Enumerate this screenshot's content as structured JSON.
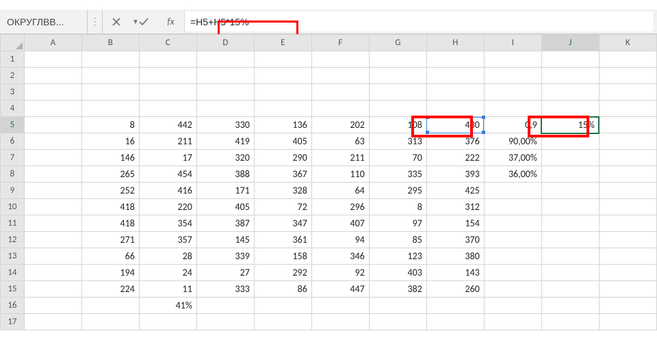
{
  "formula_bar": {
    "name_box": "ОКРУГЛВВ...",
    "fx_label": "fx",
    "formula": "=H5+H5*15%"
  },
  "columns": [
    "A",
    "B",
    "C",
    "D",
    "E",
    "F",
    "G",
    "H",
    "I",
    "J",
    "K"
  ],
  "rows": [
    "1",
    "2",
    "3",
    "4",
    "5",
    "6",
    "7",
    "8",
    "9",
    "10",
    "11",
    "12",
    "13",
    "14",
    "15",
    "16",
    "17"
  ],
  "active_col": "J",
  "active_row": "5",
  "cells": {
    "B5": "8",
    "C5": "442",
    "D5": "330",
    "E5": "136",
    "F5": "202",
    "G5": "108",
    "H5": "430",
    "I5": "0,9",
    "J5": "15%",
    "B6": "16",
    "C6": "211",
    "D6": "419",
    "E6": "405",
    "F6": "63",
    "G6": "313",
    "H6": "376",
    "I6": "90,00%",
    "B7": "146",
    "C7": "17",
    "D7": "320",
    "E7": "290",
    "F7": "211",
    "G7": "70",
    "H7": "222",
    "I7": "37,00%",
    "B8": "265",
    "C8": "454",
    "D8": "388",
    "E8": "367",
    "F8": "110",
    "G8": "335",
    "H8": "393",
    "I8": "36,00%",
    "B9": "252",
    "C9": "416",
    "D9": "171",
    "E9": "328",
    "F9": "64",
    "G9": "295",
    "H9": "425",
    "B10": "418",
    "C10": "220",
    "D10": "405",
    "E10": "72",
    "F10": "296",
    "G10": "8",
    "H10": "312",
    "B11": "418",
    "C11": "354",
    "D11": "387",
    "E11": "347",
    "F11": "407",
    "G11": "97",
    "H11": "154",
    "B12": "271",
    "C12": "357",
    "D12": "145",
    "E12": "361",
    "F12": "94",
    "G12": "85",
    "H12": "370",
    "B13": "66",
    "C13": "28",
    "D13": "339",
    "E13": "158",
    "F13": "346",
    "G13": "123",
    "H13": "380",
    "B14": "194",
    "C14": "24",
    "D14": "27",
    "E14": "292",
    "F14": "92",
    "G14": "403",
    "H14": "143",
    "B15": "224",
    "C15": "11",
    "D15": "333",
    "E15": "86",
    "F15": "447",
    "G15": "382",
    "H15": "260",
    "C16": "41%"
  }
}
